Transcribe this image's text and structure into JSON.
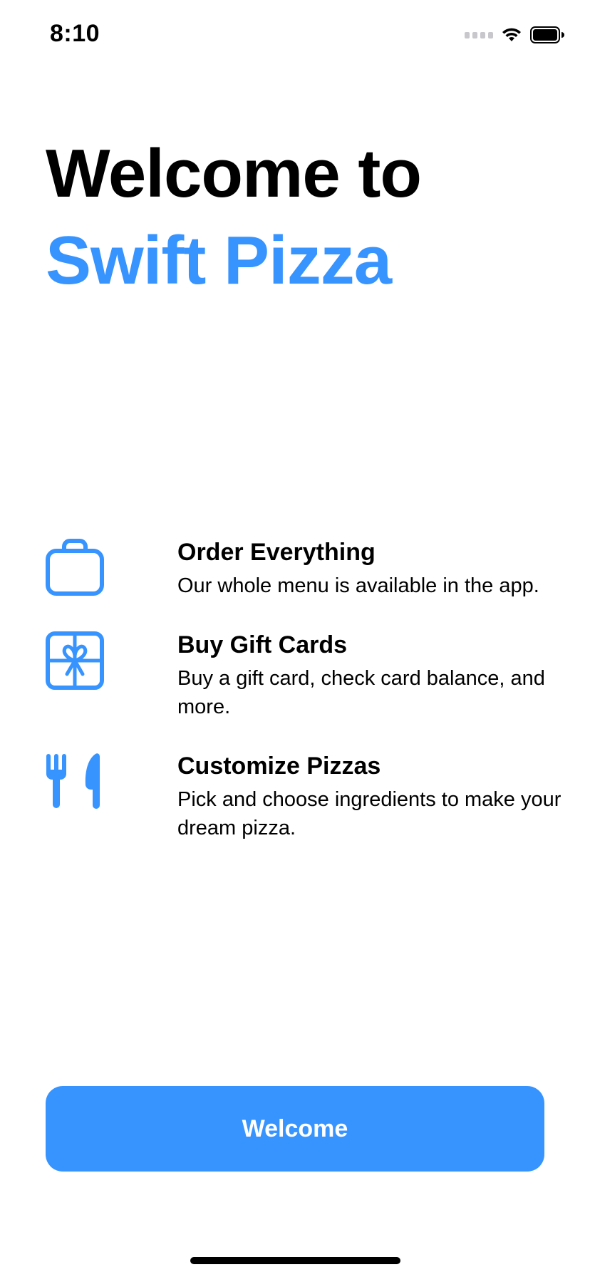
{
  "status_bar": {
    "time": "8:10",
    "signal_icon": "cellular-signal-dots",
    "wifi_icon": "wifi-icon",
    "battery_icon": "battery-full-icon"
  },
  "header": {
    "title_line1": "Welcome to",
    "title_line2": "Swift Pizza"
  },
  "features": [
    {
      "icon": "shopping-bag-icon",
      "title": "Order Everything",
      "description": "Our whole menu is available in the app."
    },
    {
      "icon": "gift-icon",
      "title": "Buy Gift Cards",
      "description": "Buy a gift card, check card balance, and more."
    },
    {
      "icon": "fork-knife-icon",
      "title": "Customize Pizzas",
      "description": "Pick and choose ingredients to make your dream pizza."
    }
  ],
  "footer": {
    "button_label": "Welcome"
  },
  "colors": {
    "accent": "#3794ff",
    "text": "#000000",
    "background": "#ffffff"
  }
}
